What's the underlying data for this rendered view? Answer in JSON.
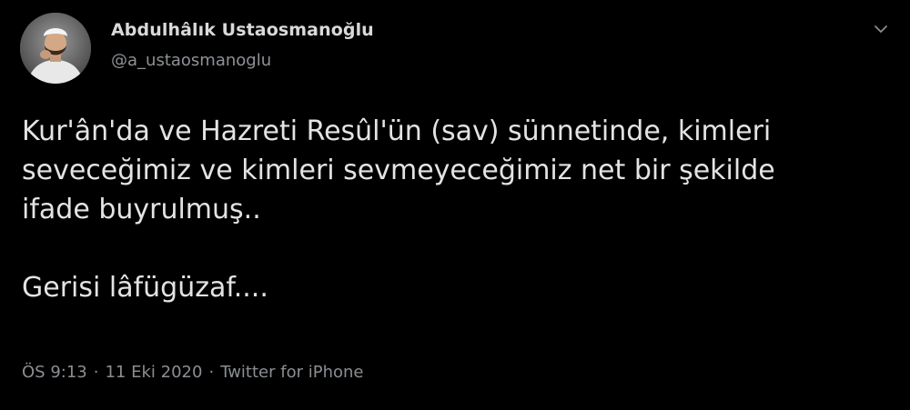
{
  "author": {
    "display_name": "Abdulhâlık Ustaosmanoğlu",
    "handle": "@a_ustaosmanoglu"
  },
  "tweet": {
    "text": "Kur'ân'da ve Hazreti Resûl'ün (sav) sünnetinde, kimleri\nseveceğimiz ve kimleri sevmeyeceğimiz net bir şekilde\nifade buyrulmuş..\n\nGerisi lâfügüzaf....",
    "time": "ÖS 9:13",
    "separator_1": "·",
    "date": "11 Eki 2020",
    "separator_2": "·",
    "source": "Twitter for iPhone"
  },
  "icons": {
    "menu": "chevron-down-icon",
    "avatar": "profile-photo"
  },
  "colors": {
    "background": "#000000",
    "primary_text": "#d9d9d9",
    "secondary_text": "#8a8e92"
  }
}
